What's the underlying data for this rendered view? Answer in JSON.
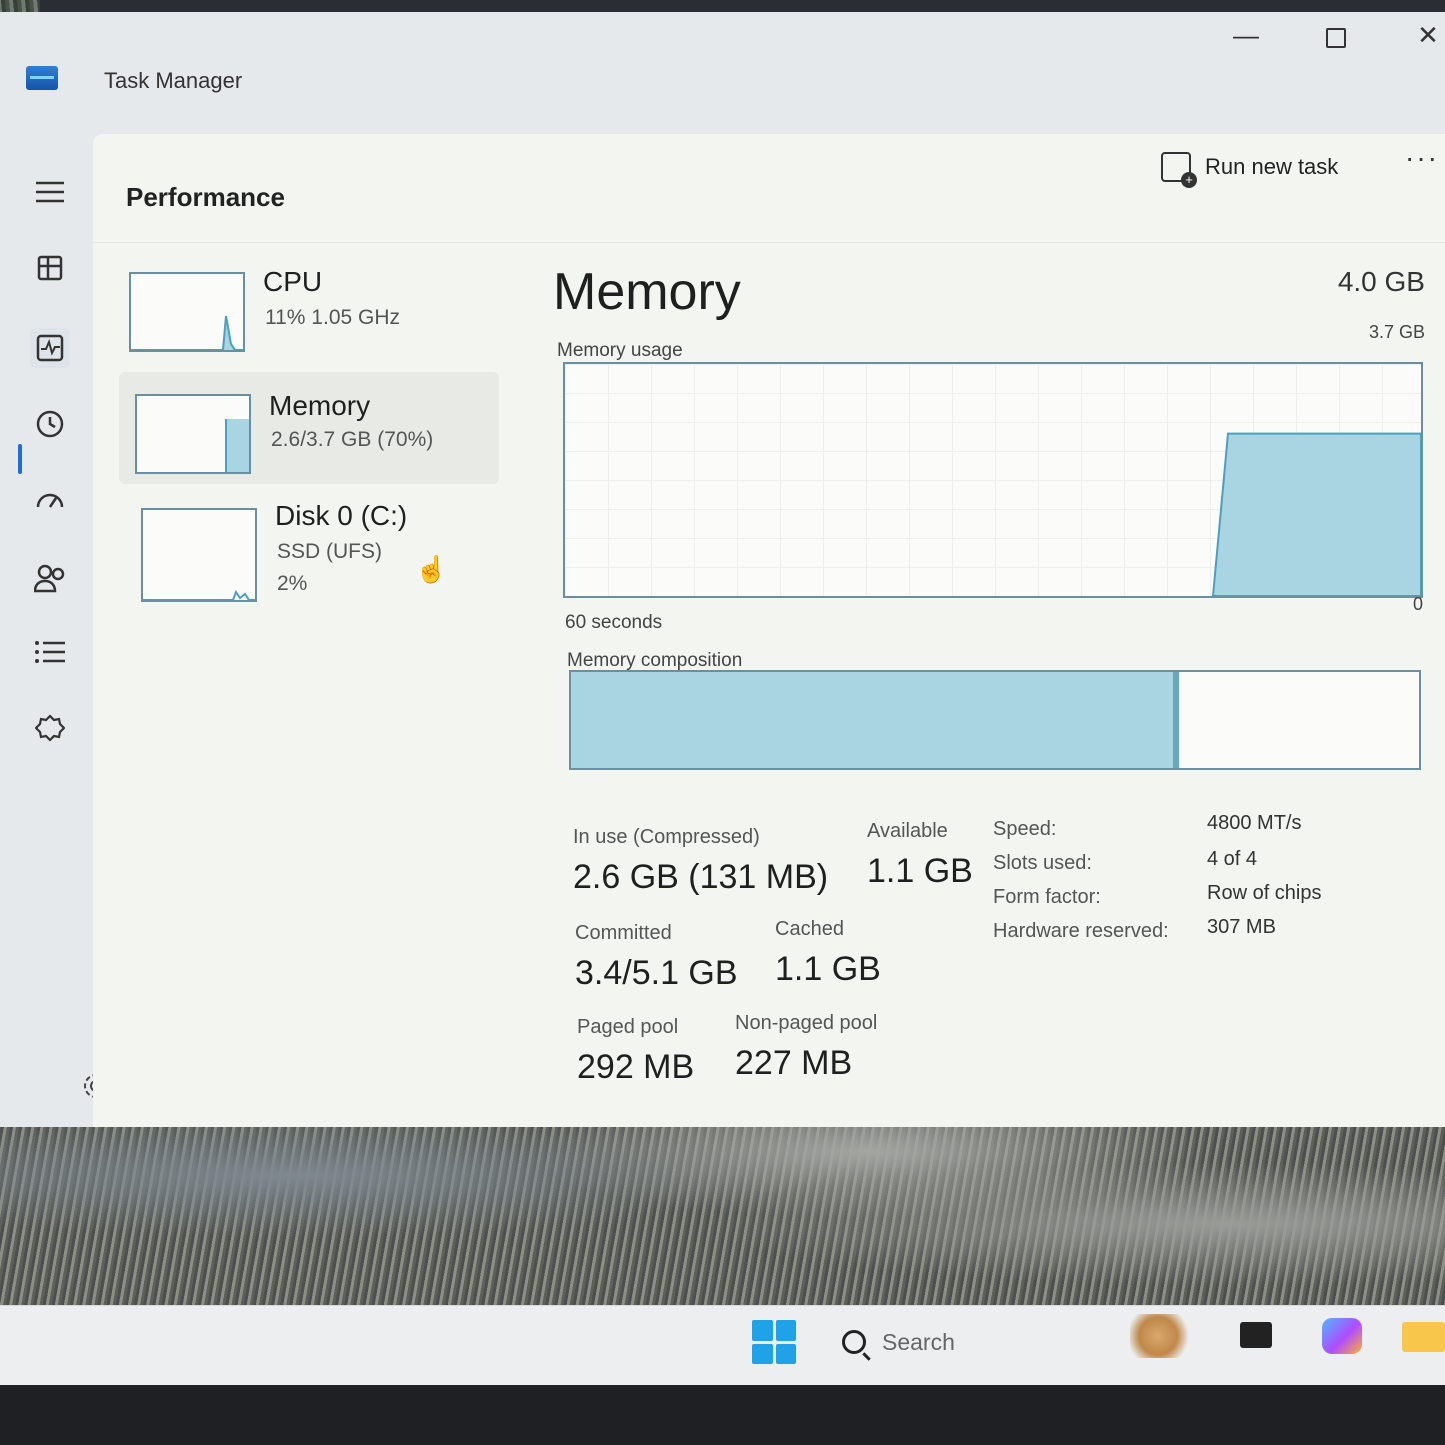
{
  "window": {
    "title": "Task Manager",
    "controls": {
      "minimize": "—",
      "close": "✕"
    }
  },
  "header": {
    "page_title": "Performance",
    "run_new_task": "Run new task",
    "more": "···"
  },
  "perf_list": [
    {
      "name": "CPU",
      "line1": "11%  1.05 GHz",
      "line2": "",
      "usage_fraction": 0.11
    },
    {
      "name": "Memory",
      "line1": "2.6/3.7 GB (70%)",
      "line2": "",
      "usage_fraction": 0.7
    },
    {
      "name": "Disk 0 (C:)",
      "line1": "SSD (UFS)",
      "line2": "2%",
      "usage_fraction": 0.02
    }
  ],
  "memory": {
    "title": "Memory",
    "total": "4.0 GB",
    "usage_label": "Memory usage",
    "usage_max": "3.7 GB",
    "time_span": "60 seconds",
    "zero": "0",
    "usage_level_fraction": 0.7,
    "composition_label": "Memory composition",
    "composition": {
      "in_use_fraction": 0.71,
      "modified_fraction": 0.01
    },
    "stats": {
      "in_use_label": "In use (Compressed)",
      "in_use_value": "2.6 GB (131 MB)",
      "available_label": "Available",
      "available_value": "1.1 GB",
      "committed_label": "Committed",
      "committed_value": "3.4/5.1 GB",
      "cached_label": "Cached",
      "cached_value": "1.1 GB",
      "paged_label": "Paged pool",
      "paged_value": "292 MB",
      "nonpaged_label": "Non-paged pool",
      "nonpaged_value": "227 MB"
    },
    "specs": [
      {
        "label": "Speed:",
        "value": "4800 MT/s"
      },
      {
        "label": "Slots used:",
        "value": "4 of 4"
      },
      {
        "label": "Form factor:",
        "value": "Row of chips"
      },
      {
        "label": "Hardware reserved:",
        "value": "307 MB"
      }
    ]
  },
  "taskbar": {
    "search_placeholder": "Search"
  },
  "colors": {
    "graph_fill": "#a9d5e3",
    "graph_border": "#6a8fa0",
    "accent": "#1f6bd8"
  },
  "icons": [
    "hamburger-icon",
    "processes-icon",
    "performance-icon",
    "app-history-icon",
    "startup-icon",
    "users-icon",
    "details-icon",
    "services-icon",
    "settings-icon",
    "run-task-icon",
    "windows-start-icon",
    "search-icon"
  ]
}
